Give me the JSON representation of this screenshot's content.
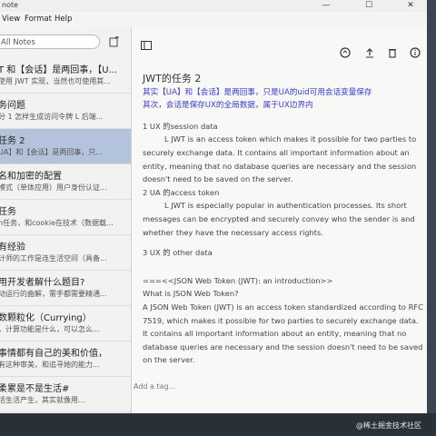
{
  "window": {
    "title": "note",
    "controls": {
      "minimize": "—",
      "maximize": "☐",
      "close": "✕"
    }
  },
  "menu": [
    "View",
    "Format",
    "Help"
  ],
  "sidebar": {
    "search_placeholder": "All Notes",
    "notes": [
      {
        "title": "T 和【会话】是两回事，【U...",
        "snippet": "使用 JWT 实现，当然也可使用其..."
      },
      {
        "title": "务问题",
        "snippet": "分 1 怎样生成访问令牌 L 后端..."
      },
      {
        "title": "任务 2",
        "snippet": "UA】和【会话】是两回事，只..."
      },
      {
        "title": "名和加密的配置",
        "snippet": "模式（单体应用）用户身份认证..."
      },
      {
        "title": "任务",
        "snippet": "n任务，和cookie在技术（数据载..."
      },
      {
        "title": "有经验",
        "snippet": "计师的工作是连生活空间（具备..."
      },
      {
        "title": "用开发者解什么题目?",
        "snippet": "动运行的曲解，需手都需要精通..."
      },
      {
        "title": "数颗粒化（Currying）",
        "snippet": "，计算功能是什么，可以怎么..."
      },
      {
        "title": "事情都有自己的美和价值，",
        "snippet": "有这种审美，和追寻她的能力..."
      },
      {
        "title": "柔累是不是生活#",
        "snippet": "活生活产生，其实就像用..."
      }
    ]
  },
  "toolbar_icons": [
    "sidebar-toggle-icon",
    "sync-icon",
    "share-icon",
    "trash-icon",
    "info-icon"
  ],
  "editor": {
    "title": "JWT的任务 2",
    "intro1": "其实【UA】和【会话】是两回事，只是UA的uid可用会话变量保存",
    "intro2": "其次，会话是保存UX的全局数据，属于UX边界内",
    "s1": "1 UX 的session data",
    "s1_body": "L JWT is an access token which makes it possible for two parties to securely exchange data. It contains all important information about an entity, meaning that no database queries are necessary and the session doesn't need to be saved on the server.",
    "s2": "2 UA 的access token",
    "s2_body": "L JWT is especially popular in authentication processes. Its short messages can be encrypted and securely convey who the sender is and whether they have the necessary access rights.",
    "s3": "3 UX 的 other data",
    "link": "===<<JSON Web Token (JWT): an introduction>>",
    "q": "What is JSON Web Token?",
    "body": "A JSON Web Token (JWT) is an access token standardized according to RFC 7519, which makes it possible for two parties to securely exchange data. It contains all important information about an entity, meaning that no database queries are necessary and the session doesn't need to be saved on the server.",
    "tag_placeholder": "Add a tag..."
  },
  "watermark": "@稀土掘金技术社区"
}
